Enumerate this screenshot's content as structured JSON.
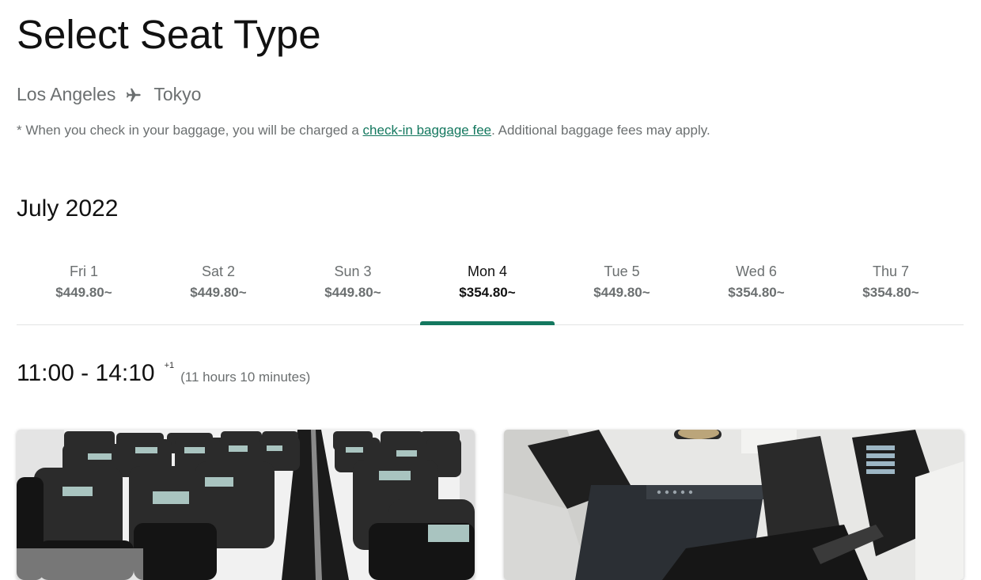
{
  "page": {
    "title": "Select Seat Type"
  },
  "route": {
    "origin": "Los Angeles",
    "destination": "Tokyo"
  },
  "notice": {
    "prefix": "* When you check in your baggage, you will be charged a ",
    "link_text": "check-in baggage fee",
    "suffix": ". Additional baggage fees may apply."
  },
  "calendar": {
    "month": "July 2022",
    "selected_index": 3,
    "days": [
      {
        "label": "Fri 1",
        "price": "$449.80~"
      },
      {
        "label": "Sat 2",
        "price": "$449.80~"
      },
      {
        "label": "Sun 3",
        "price": "$449.80~"
      },
      {
        "label": "Mon 4",
        "price": "$354.80~"
      },
      {
        "label": "Tue 5",
        "price": "$449.80~"
      },
      {
        "label": "Wed 6",
        "price": "$354.80~"
      },
      {
        "label": "Thu 7",
        "price": "$354.80~"
      }
    ]
  },
  "flight": {
    "time": "11:00 - 14:10",
    "day_offset": "+1",
    "duration": "(11 hours 10 minutes)"
  },
  "colors": {
    "accent": "#14785f",
    "muted_text": "#6b6f70"
  },
  "icons": {
    "route_separator": "airplane-icon"
  }
}
